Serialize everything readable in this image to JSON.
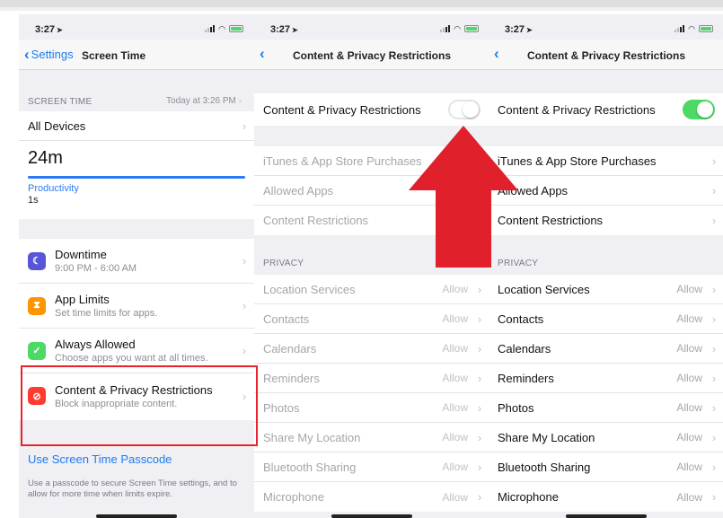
{
  "colors": {
    "ios_blue": "#1b7cf3",
    "toggle_on": "#4cd964",
    "annotation_red": "#e8232c",
    "arrow_red": "#e0202a"
  },
  "phone1": {
    "status": {
      "time": "3:27"
    },
    "nav": {
      "back_label": "Settings",
      "title": "Screen Time"
    },
    "screen_time_header": "SCREEN TIME",
    "screen_time_timestamp": "Today at 3:26 PM",
    "all_devices": "All Devices",
    "usage_total": "24m",
    "usage_category": "Productivity",
    "usage_category_time": "1s",
    "features": [
      {
        "title": "Downtime",
        "subtitle": "9:00 PM - 6:00 AM",
        "icon": "moon-icon",
        "color": "#5856d6"
      },
      {
        "title": "App Limits",
        "subtitle": "Set time limits for apps.",
        "icon": "hourglass-icon",
        "color": "#ff9500"
      },
      {
        "title": "Always Allowed",
        "subtitle": "Choose apps you want at all times.",
        "icon": "checkmark-icon",
        "color": "#4cd964"
      },
      {
        "title": "Content & Privacy Restrictions",
        "subtitle": "Block inappropriate content.",
        "icon": "restrict-icon",
        "color": "#ff3b30"
      }
    ],
    "passcode_link": "Use Screen Time Passcode",
    "passcode_note": "Use a passcode to secure Screen Time settings, and to allow for more time when limits expire."
  },
  "phone2": {
    "status": {
      "time": "3:27"
    },
    "nav": {
      "title": "Content & Privacy Restrictions"
    },
    "toggle_label": "Content & Privacy Restrictions",
    "toggle_state": "off",
    "store_rows": [
      "iTunes & App Store Purchases",
      "Allowed Apps",
      "Content Restrictions"
    ],
    "privacy_header": "PRIVACY",
    "privacy_rows": [
      {
        "label": "Location Services",
        "value": "Allow"
      },
      {
        "label": "Contacts",
        "value": "Allow"
      },
      {
        "label": "Calendars",
        "value": "Allow"
      },
      {
        "label": "Reminders",
        "value": "Allow"
      },
      {
        "label": "Photos",
        "value": "Allow"
      },
      {
        "label": "Share My Location",
        "value": "Allow"
      },
      {
        "label": "Bluetooth Sharing",
        "value": "Allow"
      },
      {
        "label": "Microphone",
        "value": "Allow"
      }
    ]
  },
  "phone3": {
    "status": {
      "time": "3:27"
    },
    "nav": {
      "title": "Content & Privacy Restrictions"
    },
    "toggle_label": "Content & Privacy Restrictions",
    "toggle_state": "on",
    "store_rows": [
      "iTunes & App Store Purchases",
      "Allowed Apps",
      "Content Restrictions"
    ],
    "privacy_header": "PRIVACY",
    "privacy_rows": [
      {
        "label": "Location Services",
        "value": "Allow"
      },
      {
        "label": "Contacts",
        "value": "Allow"
      },
      {
        "label": "Calendars",
        "value": "Allow"
      },
      {
        "label": "Reminders",
        "value": "Allow"
      },
      {
        "label": "Photos",
        "value": "Allow"
      },
      {
        "label": "Share My Location",
        "value": "Allow"
      },
      {
        "label": "Bluetooth Sharing",
        "value": "Allow"
      },
      {
        "label": "Microphone",
        "value": "Allow"
      }
    ]
  }
}
